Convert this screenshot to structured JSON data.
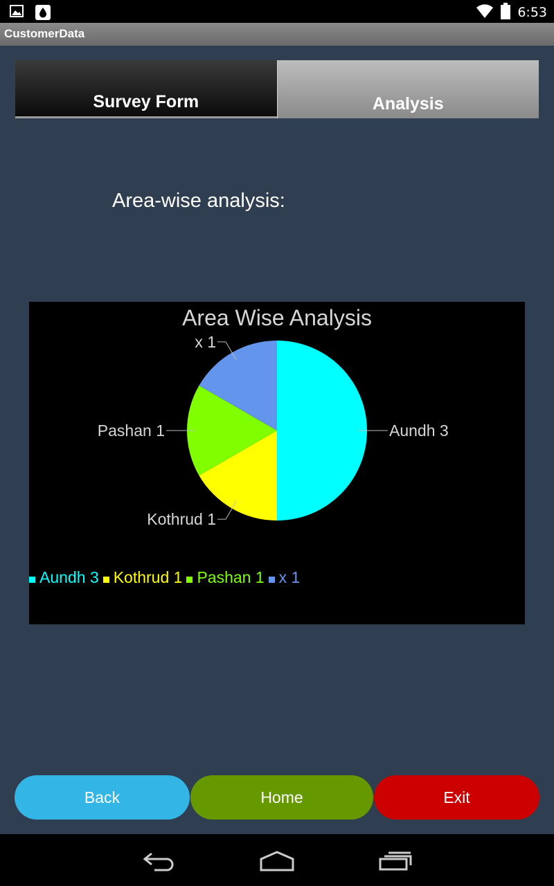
{
  "status_bar": {
    "time": "6:53",
    "icons": [
      "image-notification-icon",
      "drop-notification-icon",
      "wifi-icon",
      "battery-icon"
    ]
  },
  "app": {
    "title": "CustomerData"
  },
  "tabs": [
    {
      "label": "Survey Form",
      "selected": false
    },
    {
      "label": "Analysis",
      "selected": true
    }
  ],
  "heading": "Area-wise analysis:",
  "chart_data": {
    "type": "pie",
    "title": "Area Wise Analysis",
    "categories": [
      "Aundh",
      "Kothrud",
      "Pashan",
      "x"
    ],
    "values": [
      3,
      1,
      1,
      1
    ],
    "labels": [
      "Aundh 3",
      "Kothrud 1",
      "Pashan 1",
      "x 1"
    ],
    "colors": [
      "#00ffff",
      "#ffff00",
      "#7fff00",
      "#6495ed"
    ],
    "legend": "bottom-left",
    "background": "#000000"
  },
  "buttons": {
    "back": "Back",
    "home": "Home",
    "exit": "Exit"
  },
  "nav": [
    "back-icon",
    "home-icon",
    "recents-icon"
  ]
}
